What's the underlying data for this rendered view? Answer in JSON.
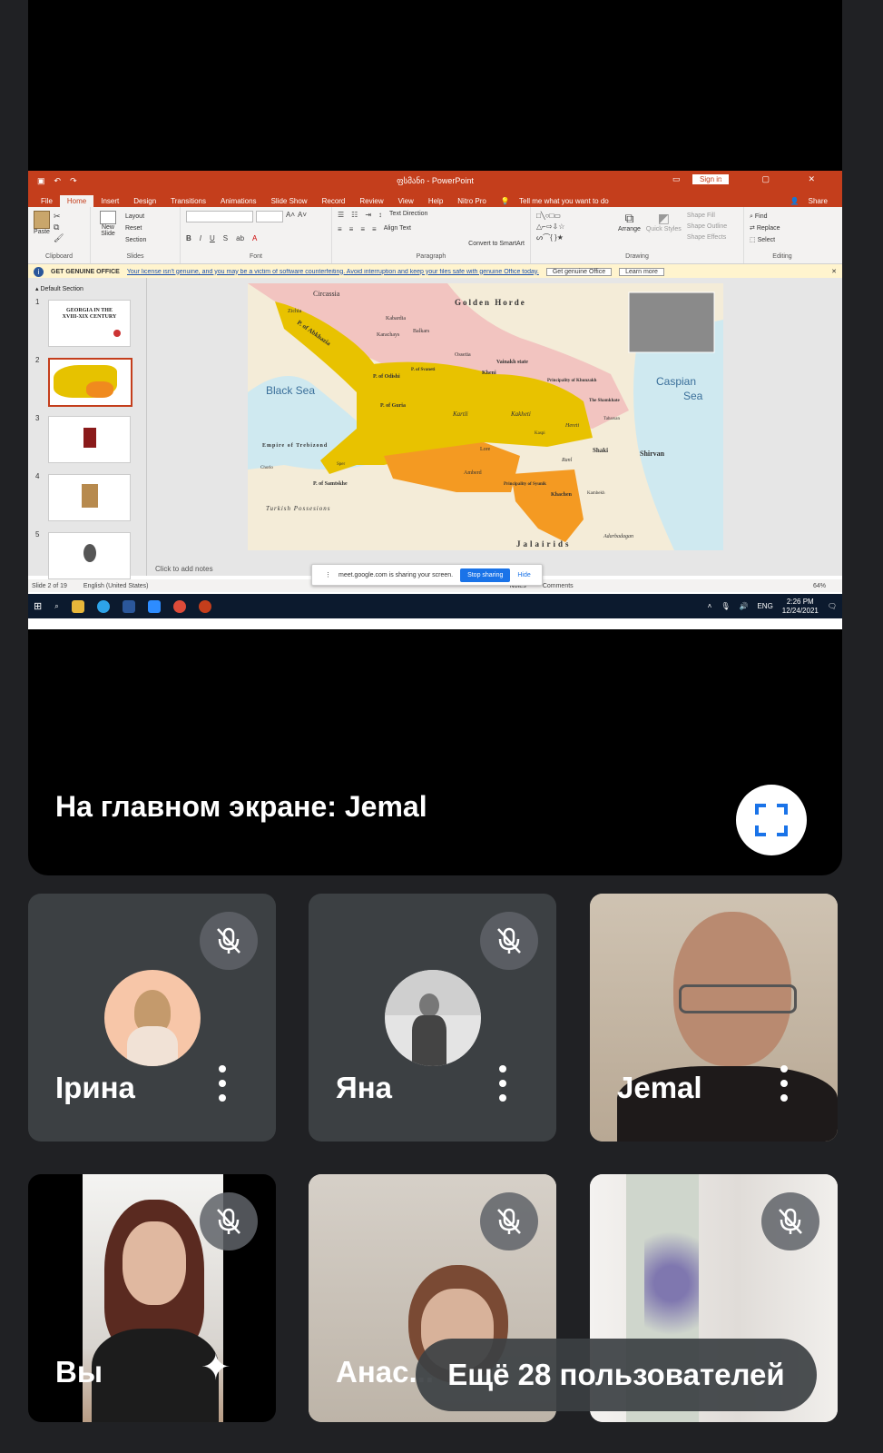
{
  "main_stage": {
    "presenter_label": "На главном экране: Jemal",
    "fullscreen_icon": "fullscreen-icon"
  },
  "powerpoint": {
    "title": "ფსმანი - PowerPoint",
    "signin": "Sign in",
    "tabs": [
      "File",
      "Home",
      "Insert",
      "Design",
      "Transitions",
      "Animations",
      "Slide Show",
      "Record",
      "Review",
      "View",
      "Help",
      "Nitro Pro"
    ],
    "tell_me": "Tell me what you want to do",
    "share": "Share",
    "ribbon": {
      "clipboard": "Clipboard",
      "paste": "Paste",
      "slides": "Slides",
      "new_slide": "New Slide",
      "layout": "Layout",
      "reset": "Reset",
      "section": "Section",
      "font": "Font",
      "paragraph": "Paragraph",
      "text_direction": "Text Direction",
      "align_text": "Align Text",
      "convert": "Convert to SmartArt",
      "drawing": "Drawing",
      "arrange": "Arrange",
      "quick_styles": "Quick Styles",
      "shape_fill": "Shape Fill",
      "shape_outline": "Shape Outline",
      "shape_effects": "Shape Effects",
      "editing": "Editing",
      "find": "Find",
      "replace": "Replace",
      "select": "Select"
    },
    "notice": {
      "label": "GET GENUINE OFFICE",
      "text": "Your license isn't genuine, and you may be a victim of software counterfeiting. Avoid interruption and keep your files safe with genuine Office today.",
      "btn1": "Get genuine Office",
      "btn2": "Learn more"
    },
    "section_label": "Default Section",
    "slide_numbers": [
      "1",
      "2",
      "3",
      "4",
      "5"
    ],
    "slide1_title": "GEORGIA IN THE XVIII-XIX CENTURY",
    "notes_placeholder": "Click to add notes",
    "status": {
      "slide": "Slide 2 of 19",
      "lang": "English (United States)",
      "notes": "Notes",
      "comments": "Comments",
      "zoom": "64%"
    },
    "map_labels": {
      "circassia": "Circassia",
      "golden_horde": "Golden Horde",
      "black_sea": "Black Sea",
      "caspian": "Caspian",
      "sea": "Sea",
      "abkhazia": "P. of Abkhazia",
      "zichia": "Zichia",
      "kabardia": "Kabardia",
      "karachays": "Karachays",
      "balkars": "Balkars",
      "ossetia": "Ossetia",
      "vainakh": "Vainakh state",
      "odishi": "P. of Odishi",
      "svaneti": "P. of Svaneti",
      "guria": "P. of Guria",
      "kartli": "Kartli",
      "kakheti": "Kakheti",
      "kheni": "Kheni",
      "khunzakh": "Principality of Khunzakh",
      "shamkhate": "The Shamkhate",
      "hereti": "Hereti",
      "shaki": "Shaki",
      "shirvan": "Shirvan",
      "trebizond": "Empire of Trebizond",
      "samtskhe": "P. of Samtskhe",
      "syunik": "Principality of Syunik",
      "khachen": "Khachen",
      "turkish": "Turkish Possesions",
      "jalairids": "Jalairids",
      "adarbadagan": "Adarbadagan",
      "kakheti2": "Kakheti",
      "lori": "Lore",
      "ani": "Ani",
      "amberd": "Amberd",
      "ranl": "Ranl",
      "kaspi": "Kaspi",
      "chorlo": "Chorlo",
      "sper": "Sper",
      "gagri": "Gagri",
      "tabarsan": "Tabarsan",
      "kambekh": "Kambekh"
    }
  },
  "meet_share": {
    "text": "meet.google.com is sharing your screen.",
    "stop": "Stop sharing",
    "hide": "Hide"
  },
  "taskbar": {
    "lang": "ENG",
    "time": "2:26 PM",
    "date": "12/24/2021"
  },
  "participants": [
    {
      "name": "Ірина",
      "muted": true
    },
    {
      "name": "Яна",
      "muted": true
    },
    {
      "name": "Jemal",
      "muted": false
    },
    {
      "name": "Вы",
      "muted": true
    },
    {
      "name": "Анас...",
      "muted": true
    },
    {
      "name": "",
      "muted": true
    }
  ],
  "more_participants": "Ещё 28 пользователей"
}
